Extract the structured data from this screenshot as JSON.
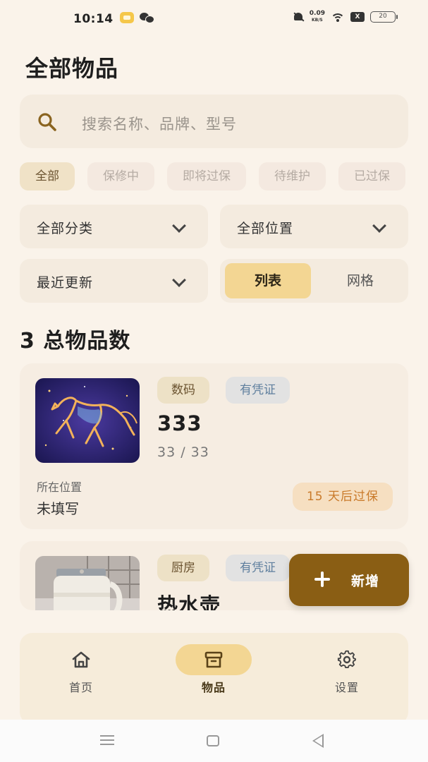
{
  "status_bar": {
    "time": "10:14",
    "net_speed_value": "0.09",
    "net_speed_unit": "KB/S",
    "sim_label": "X",
    "battery": "20"
  },
  "page": {
    "title": "全部物品"
  },
  "search": {
    "placeholder": "搜索名称、品牌、型号"
  },
  "filter_chips": [
    "全部",
    "保修中",
    "即将过保",
    "待维护",
    "已过保"
  ],
  "selects": {
    "category": "全部分类",
    "location": "全部位置",
    "sort": "最近更新"
  },
  "view_toggle": {
    "list": "列表",
    "grid": "网格",
    "active": "list"
  },
  "summary": {
    "count_text": "3 总物品数"
  },
  "items": [
    {
      "category": "数码",
      "cert": "有凭证",
      "name": "333",
      "model": "33 / 33",
      "location_label": "所在位置",
      "location_value": "未填写",
      "warranty": "15 天后过保",
      "thumb": "horse-constellation"
    },
    {
      "category": "厨房",
      "cert": "有凭证",
      "name": "热水壶",
      "thumb": "kettle"
    }
  ],
  "fab": {
    "label": "新增"
  },
  "bottom_nav": [
    {
      "label": "首页",
      "icon": "home-icon"
    },
    {
      "label": "物品",
      "icon": "box-icon"
    },
    {
      "label": "设置",
      "icon": "gear-icon"
    }
  ],
  "colors": {
    "background": "#faf3ea",
    "accent": "#f3d693",
    "fab": "#8a5e14",
    "warranty_text": "#c97a2a"
  }
}
